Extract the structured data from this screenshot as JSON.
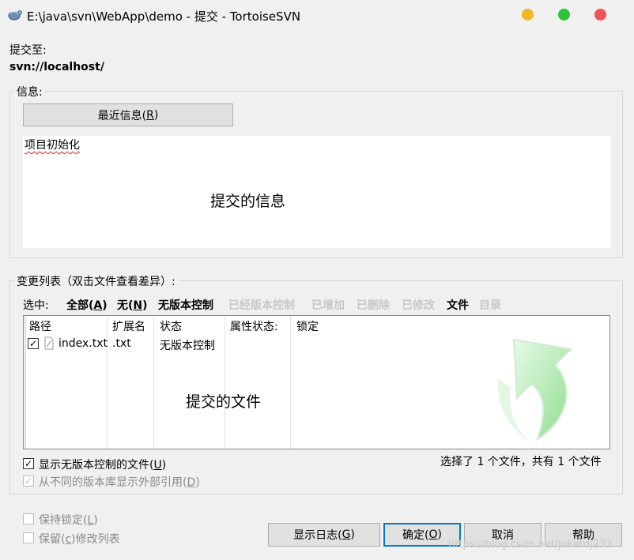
{
  "window": {
    "title": "E:\\java\\svn\\WebApp\\demo - 提交 - TortoiseSVN"
  },
  "commit_to": {
    "label": "提交至:",
    "url": "svn://localhost/"
  },
  "message_group": {
    "title": "信息:",
    "recent_button": {
      "text": "最近信息(",
      "key": "R",
      "end": ")"
    },
    "message_text": "项目初始化",
    "annotation": "提交的信息"
  },
  "changes_group": {
    "title": "变更列表（双击文件查看差异）:",
    "select_label": "选中:",
    "filters": [
      {
        "text": "全部(",
        "key": "A",
        "end": ")",
        "enabled": true
      },
      {
        "text": "无(",
        "key": "N",
        "end": ")",
        "enabled": true
      },
      {
        "text": "无版本控制",
        "enabled": true
      },
      {
        "text": "已经版本控制",
        "enabled": false
      },
      {
        "text": "已增加",
        "enabled": false
      },
      {
        "text": "已删除",
        "enabled": false
      },
      {
        "text": "已修改",
        "enabled": false
      },
      {
        "text": "文件",
        "enabled": true
      },
      {
        "text": "目录",
        "enabled": false
      }
    ],
    "columns": [
      "路径",
      "扩展名",
      "状态",
      "属性状态:",
      "锁定"
    ],
    "rows": [
      {
        "checked": true,
        "path": "index.txt",
        "extension": ".txt",
        "status": "无版本控制"
      }
    ],
    "annotation": "提交的文件",
    "show_unversioned": {
      "text": "显示无版本控制的文件(",
      "key": "U",
      "end": ")",
      "checked": true
    },
    "show_externals": {
      "text": "从不同的版本库显示外部引用(",
      "key": "D",
      "end": ")",
      "checked": true
    },
    "selection_summary": "选择了 1 个文件，共有 1 个文件"
  },
  "options": {
    "keep_locks": {
      "text": "保持锁定(",
      "key": "L",
      "end": ")",
      "checked": false
    },
    "keep_changelists": {
      "text": "保留(",
      "key": "c",
      "end": ")修改列表",
      "checked": false
    }
  },
  "buttons": {
    "show_log": {
      "text": "显示日志(",
      "key": "G",
      "end": ")"
    },
    "ok": {
      "text": "确定(",
      "key": "O",
      "end": ")"
    },
    "cancel": "取消",
    "help": "帮助"
  },
  "watermark": "https://blog.csdn.net/jokerdj233",
  "colors": {
    "accent_blue": "#0078d7",
    "window_bg": "#f0f0f0",
    "min": "#f5b623",
    "max": "#30c23f",
    "close": "#f0545a",
    "arrow_green": "#9fe39f"
  }
}
